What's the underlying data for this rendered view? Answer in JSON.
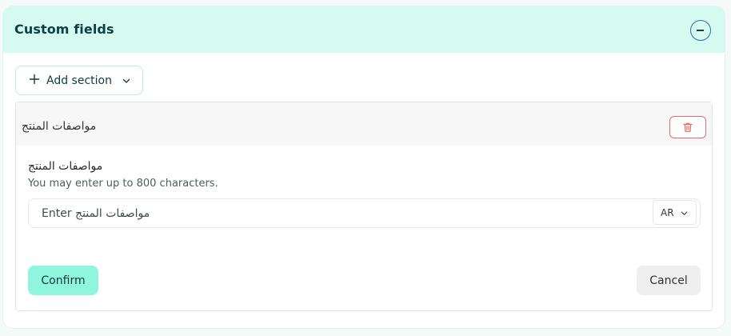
{
  "panel": {
    "title": "Custom fields",
    "collapse_icon": "minus-circle-icon"
  },
  "toolbar": {
    "add_section_label": "Add section",
    "add_icon": "plus-icon",
    "dropdown_icon": "chevron-down-icon"
  },
  "section": {
    "title": "مواصفات المنتج",
    "delete_icon": "trash-icon",
    "field": {
      "label": "مواصفات المنتج",
      "hint": "You may enter up to 800 characters.",
      "value": "",
      "placeholder": "Enter مواصفات المنتج",
      "language": "AR"
    }
  },
  "actions": {
    "confirm_label": "Confirm",
    "cancel_label": "Cancel"
  },
  "colors": {
    "header_background": "#d5fbf1",
    "confirm_background": "#8ff5dc",
    "delete_accent": "#e26b6b",
    "cancel_background": "#eeeeee"
  }
}
